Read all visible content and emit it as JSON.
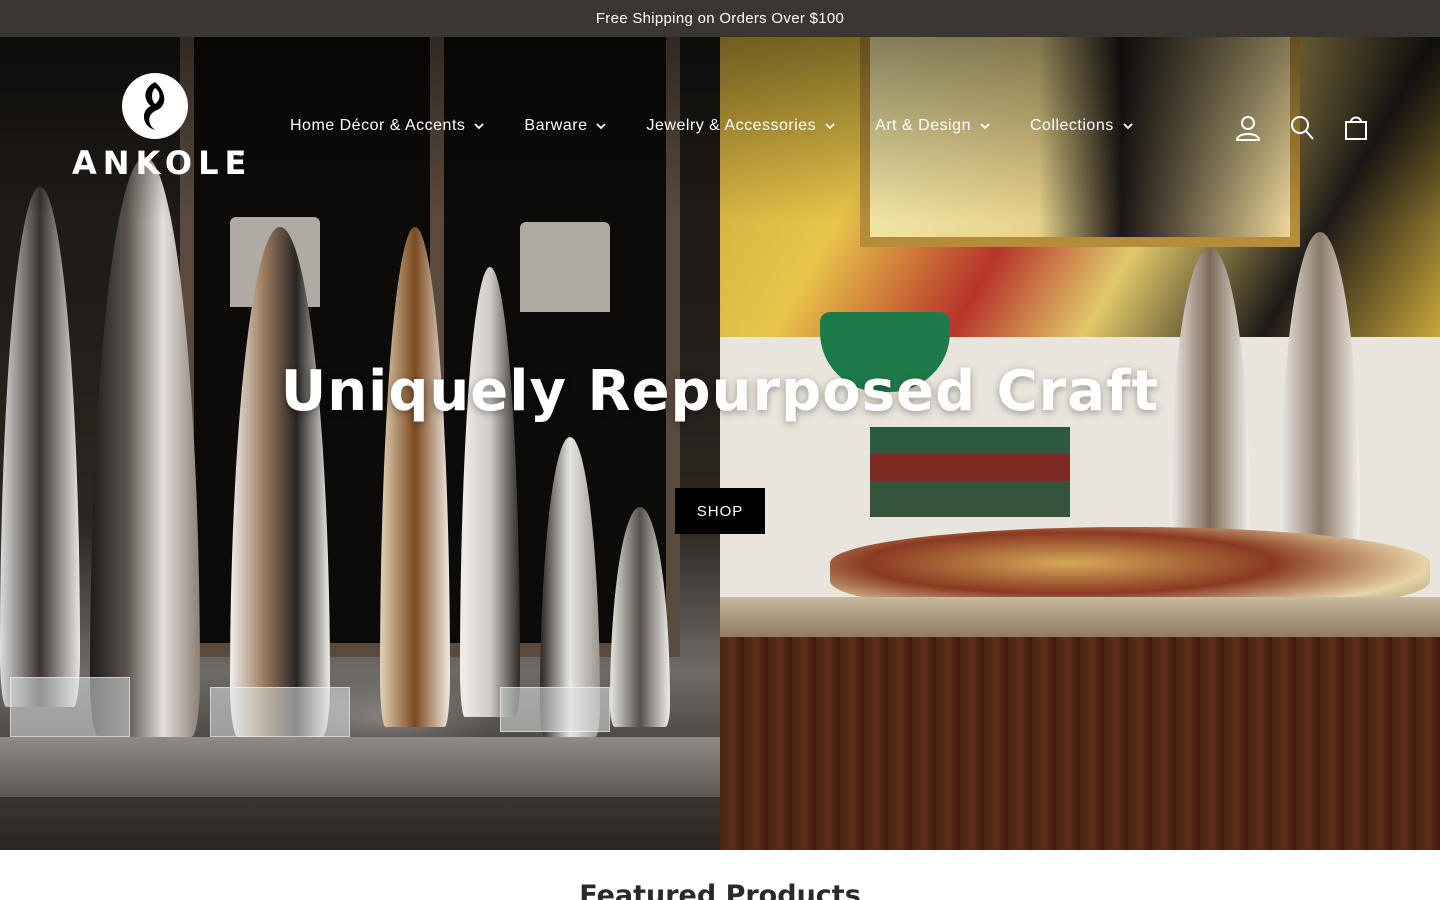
{
  "announcement": {
    "text": "Free Shipping on Orders Over $100"
  },
  "brand": {
    "name": "ANKOLE",
    "trademark": "™"
  },
  "nav": {
    "items": [
      {
        "label": "Home Décor & Accents"
      },
      {
        "label": "Barware"
      },
      {
        "label": "Jewelry & Accessories"
      },
      {
        "label": "Art & Design"
      },
      {
        "label": "Collections"
      }
    ]
  },
  "header_icons": [
    "account-icon",
    "search-icon",
    "cart-icon"
  ],
  "hero": {
    "title": "Uniquely Repurposed Craft",
    "button_label": "SHOP"
  },
  "featured": {
    "title": "Featured Products"
  },
  "colors": {
    "announcement_bg": "#3a3632",
    "button_bg": "#000000",
    "text_light": "#ffffff"
  }
}
